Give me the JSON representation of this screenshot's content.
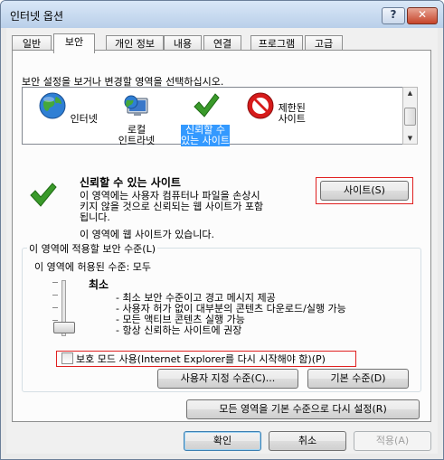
{
  "window": {
    "title": "인터넷 옵션",
    "help_label": "?",
    "close_label": "✕"
  },
  "tabs": [
    {
      "label": "일반"
    },
    {
      "label": "보안"
    },
    {
      "label": "개인 정보"
    },
    {
      "label": "내용"
    },
    {
      "label": "연결"
    },
    {
      "label": "프로그램"
    },
    {
      "label": "고급"
    }
  ],
  "active_tab": "보안",
  "instruction": "보안 설정을 보거나 변경할 영역을 선택하십시오.",
  "zones": [
    {
      "line1": "인터넷",
      "line2": "",
      "icon": "globe-icon"
    },
    {
      "line1": "로컬",
      "line2": "인트라넷",
      "icon": "intranet-icon"
    },
    {
      "line1": "신뢰할 수",
      "line2": "있는 사이트",
      "icon": "checkmark-icon",
      "selected": true
    },
    {
      "line1": "제한된",
      "line2": "사이트",
      "icon": "restricted-icon"
    }
  ],
  "zone_info": {
    "title": "신뢰할 수 있는 사이트",
    "desc1": "이 영역에는 사용자 컴퓨터나 파일을 손상시",
    "desc2": "키지 않을 것으로 신뢰되는 웹 사이트가 포함",
    "desc3": "됩니다.",
    "sites_note": "이 영역에 웹 사이트가 있습니다.",
    "sites_button": "사이트(S)"
  },
  "security_level": {
    "group_title": "이 영역에 적용할 보안 수준(L)",
    "allowed_levels": "이 영역에 허용된 수준: 모두",
    "level_name": "최소",
    "bullets": [
      "- 최소 보안 수준이고 경고 메시지 제공",
      "- 사용자 허가 없이 대부분의 콘텐츠 다운로드/실행 가능",
      "- 모든 액티브 콘텐츠 실행 가능",
      "- 항상 신뢰하는 사이트에 권장"
    ],
    "protected_mode_label": "보호 모드 사용(Internet Explorer를 다시 시작해야 함)(P)",
    "protected_mode_checked": false,
    "custom_level_button": "사용자 지정 수준(C)...",
    "default_level_button": "기본 수준(D)"
  },
  "reset_all_button": "모든 영역을 기본 수준으로 다시 설정(R)",
  "footer": {
    "ok": "확인",
    "cancel": "취소",
    "apply": "적용(A)"
  },
  "colors": {
    "highlight_box": "#e02020",
    "selection": "#3399ff",
    "check_green": "#3a9a2a",
    "restricted_red": "#d61b1b"
  }
}
